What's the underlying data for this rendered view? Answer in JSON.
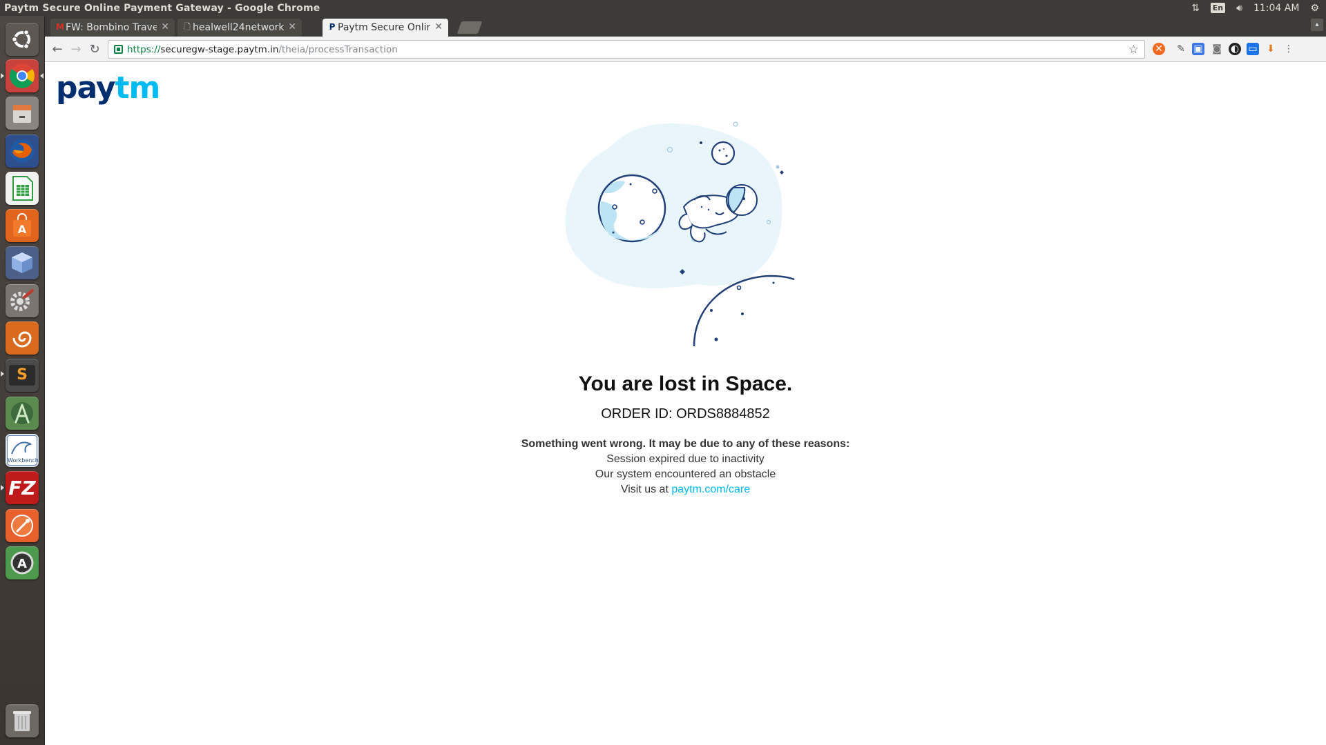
{
  "system": {
    "window_title": "Paytm Secure Online Payment Gateway - Google Chrome",
    "keyboard_layout": "En",
    "clock": "11:04 AM"
  },
  "launcher": {
    "apps": [
      {
        "name": "Ubuntu Dash",
        "icon": "ubuntu-icon"
      },
      {
        "name": "Google Chrome",
        "icon": "chrome-icon"
      },
      {
        "name": "Files",
        "icon": "file-cabinet-icon"
      },
      {
        "name": "Firefox",
        "icon": "firefox-icon"
      },
      {
        "name": "LibreOffice Calc",
        "icon": "spreadsheet-icon"
      },
      {
        "name": "Ubuntu Software",
        "icon": "shopping-bag-icon"
      },
      {
        "name": "VirtualBox",
        "icon": "cube-icon"
      },
      {
        "name": "System Settings",
        "icon": "settings-icon"
      },
      {
        "name": "Remmina",
        "icon": "swirl-icon"
      },
      {
        "name": "Sublime Text",
        "icon": "sublime-icon"
      },
      {
        "name": "Android Studio",
        "icon": "android-studio-icon"
      },
      {
        "name": "MySQL Workbench",
        "icon": "workbench-icon"
      },
      {
        "name": "FileZilla",
        "icon": "filezilla-icon"
      },
      {
        "name": "Postman",
        "icon": "postman-icon"
      },
      {
        "name": "Software Updater",
        "icon": "updater-icon"
      },
      {
        "name": "Trash",
        "icon": "trash-icon"
      }
    ],
    "workbench_label": "Workbench",
    "filezilla_label": "FZ",
    "sublime_label": "S"
  },
  "browser": {
    "tabs": [
      {
        "title": "FW: Bombino Trave",
        "favicon": "gmail-icon",
        "active": false
      },
      {
        "title": "healwell24network",
        "favicon": "document-icon",
        "active": false
      },
      {
        "title": "Paytm Secure Onlin",
        "favicon": "paytm-icon",
        "active": true
      }
    ],
    "address_bar": {
      "scheme": "https://",
      "host": "securegw-stage.paytm.in",
      "path": "/theia/processTransaction"
    }
  },
  "page": {
    "logo": {
      "part1": "pay",
      "part2": "tm"
    },
    "headline": "You are lost in Space.",
    "order_id": "ORDER ID: ORDS8884852",
    "reasons_title": "Something went wrong. It may be due to any of these reasons:",
    "reasons": [
      "Session expired due to inactivity",
      "Our system encountered an obstacle"
    ],
    "visit_prefix": "Visit us at ",
    "visit_link": "paytm.com/care"
  },
  "colors": {
    "paytm_navy": "#002e6e",
    "paytm_blue": "#00baf2",
    "illustration_stroke": "#1e3f78",
    "illustration_bg": "#eaf6fb"
  }
}
